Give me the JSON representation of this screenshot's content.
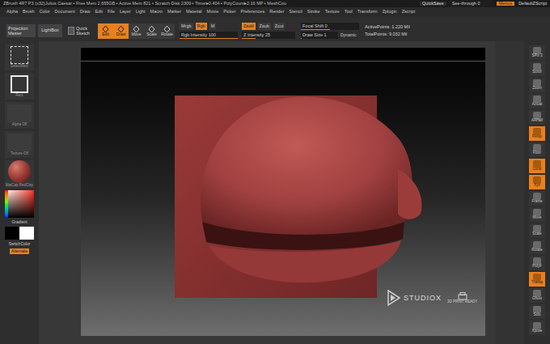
{
  "title_bar": {
    "text": "ZBrush 4R7 P3 (x32)Julius Caesar ▪ Free Mem 2.655GB ▪ Active Mem 821 ▪ Scratch Disk 2309 ▪ Timer▸0.404 ▪ PolyCount▸2.16 MP ▪ MeshCou",
    "quicksave": "QuickSave",
    "see_through": {
      "label": "See-through 0",
      "level": 0
    },
    "menus": {
      "label": "Menus",
      "on": true
    },
    "script": "DefaultZScript"
  },
  "menu": [
    "Alpha",
    "Brush",
    "Color",
    "Document",
    "Draw",
    "Edit",
    "File",
    "Layer",
    "Light",
    "Macro",
    "Marker",
    "Material",
    "Movie",
    "Picker",
    "Preferences",
    "Render",
    "Stencil",
    "Stroke",
    "Texture",
    "Tool",
    "Transform",
    "Zplugin",
    "Zscript"
  ],
  "toolbar": {
    "buttons": [
      "Projection Master",
      "LightBox",
      "Quick Sketch"
    ],
    "modes": [
      {
        "label": "Edit",
        "selected": true
      },
      {
        "label": "Draw",
        "selected": true
      },
      {
        "label": "Move",
        "selected": false
      },
      {
        "label": "Scale",
        "selected": false
      },
      {
        "label": "Rotate",
        "selected": false
      }
    ],
    "color_modes": [
      {
        "label": "Mrgb",
        "selected": false
      },
      {
        "label": "Rgb",
        "selected": true
      },
      {
        "label": "M",
        "selected": false
      }
    ],
    "rgb_intensity": {
      "label": "Rgb Intensity 100",
      "level": 1
    },
    "z_modes": [
      {
        "label": "Zadd",
        "selected": true
      },
      {
        "label": "Zsub",
        "selected": false
      },
      {
        "label": "Zcut",
        "selected": false
      }
    ],
    "z_intensity": {
      "label": "Z Intensity 25",
      "level": 0.25
    },
    "focal_shift": {
      "label": "Focal Shift 0",
      "level": 0.5
    },
    "draw_size": {
      "label": "Draw Size 1",
      "level": 0.01
    },
    "dynamic": "Dynamic",
    "stats": [
      "ActivePoints: 1.220 Mil",
      "TotalPoints: 9.032 Mil"
    ]
  },
  "left_shelf": {
    "items": [
      {
        "label": "SelectRect",
        "kind": "dotted"
      },
      {
        "label": "Rect",
        "kind": "square"
      },
      {
        "label": "Alpha Off",
        "kind": "empty"
      },
      {
        "label": "Texture Off",
        "kind": "empty"
      },
      {
        "label": "MatCap RedClay",
        "kind": "material"
      }
    ],
    "gradient": "Gradient",
    "switch_color": "SwitchColor",
    "alternate": {
      "label": "Alternate",
      "on": true
    }
  },
  "canvas": {
    "logo": {
      "name": "STUDIOX",
      "badge": "3D PRINT READY"
    }
  },
  "right_shelf": [
    {
      "label": "SPix 3",
      "selected": false
    },
    {
      "label": "Scroll",
      "selected": false
    },
    {
      "label": "Zoom",
      "selected": false
    },
    {
      "label": "Actual",
      "selected": false
    },
    {
      "label": "AAHalf",
      "selected": false
    },
    {
      "label": "Persp",
      "selected": true
    },
    {
      "label": "Floor",
      "selected": false
    },
    {
      "label": "Local",
      "selected": true
    },
    {
      "label": "Xyz",
      "selected": true
    },
    {
      "label": "Frame",
      "selected": false
    },
    {
      "label": "Move",
      "selected": false
    },
    {
      "label": "Scale",
      "selected": false
    },
    {
      "label": "Rotate",
      "selected": false
    },
    {
      "label": "PolyF",
      "selected": false
    },
    {
      "label": "Transp",
      "selected": true
    },
    {
      "label": "Ghost",
      "selected": false
    },
    {
      "label": "Solo",
      "selected": false
    },
    {
      "label": "Xpose",
      "selected": false
    }
  ]
}
